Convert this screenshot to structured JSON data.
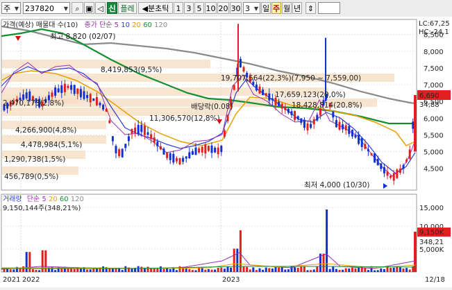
{
  "toolbar": {
    "market": "주",
    "code": "237820",
    "search_icon": "magnifier-icon",
    "lock_icon": "padlock-icon",
    "speaker_icon": "speaker-icon",
    "tag_sin": "신",
    "tag_flare": "플레",
    "prev_period": "◀분초틱",
    "periods": [
      "1",
      "3",
      "5",
      "10",
      "20",
      "30"
    ],
    "count": "3",
    "day": "일",
    "week": "주",
    "month": "월",
    "year": "년",
    "updown_icon": "up-down-arrows-icon",
    "colors": {
      "selected_bg": "#fff3b0",
      "selected_text": "#b01010"
    }
  },
  "price_panel": {
    "legend_left": "가격(예상)",
    "legend_ma": "매물대 수(10)",
    "legend_sma": "종가 단순",
    "legend_periods": [
      "5",
      "10",
      "20",
      "60",
      "120"
    ],
    "lc": "LC:67,25",
    "hc": "HC:-24,1",
    "current_price": "6,690",
    "pct_label": "34,88",
    "high_label": "최고 8,820 (02/07)",
    "low_label": "최저 4,000 (10/30)",
    "dividend_label": "배당락(0.08)",
    "y_ticks": [
      "8,500",
      "8,000",
      "7,500",
      "7,000",
      "6,500",
      "6,000",
      "5,500",
      "5,000",
      "4,500"
    ]
  },
  "volume_profile": [
    {
      "label": "19,707,564(22,3%)(7,950 ~ 7,559,00)"
    },
    {
      "label": "17,659,123(20,0%)"
    },
    {
      "label": "18,428,814(20,8%)"
    },
    {
      "label": "8,419,853(9,5%)"
    },
    {
      "label": "11,306,570(12,8%)"
    },
    {
      "label": "2,470,173(2,8%)"
    },
    {
      "label": "4,266,900(4,8%)"
    },
    {
      "label": "4,478,984(5,1%)"
    },
    {
      "label": "1,290,738(1,5%)"
    },
    {
      "label": "456,789(0,5%)"
    }
  ],
  "volume_panel": {
    "legend": "거래량",
    "legend_sma": "단순",
    "legend_periods": [
      "5",
      "20",
      "60",
      "120"
    ],
    "value": "9,150,144주(348,21%)",
    "y_ticks": [
      "15,000",
      "10,000",
      "5,000K"
    ],
    "current": "9,150K",
    "current_pct": "348,21"
  },
  "x_axis": {
    "labels": [
      "2021",
      "2022",
      "2023",
      "12/18"
    ]
  },
  "colors": {
    "up": "#e02020",
    "down": "#1030d0",
    "ma5": "#9a2fb0",
    "ma10": "#2a3fd0",
    "ma20": "#e8a000",
    "ma60": "#109030",
    "ma120": "#8a8a8a",
    "profile": "#f5dcc0"
  }
}
